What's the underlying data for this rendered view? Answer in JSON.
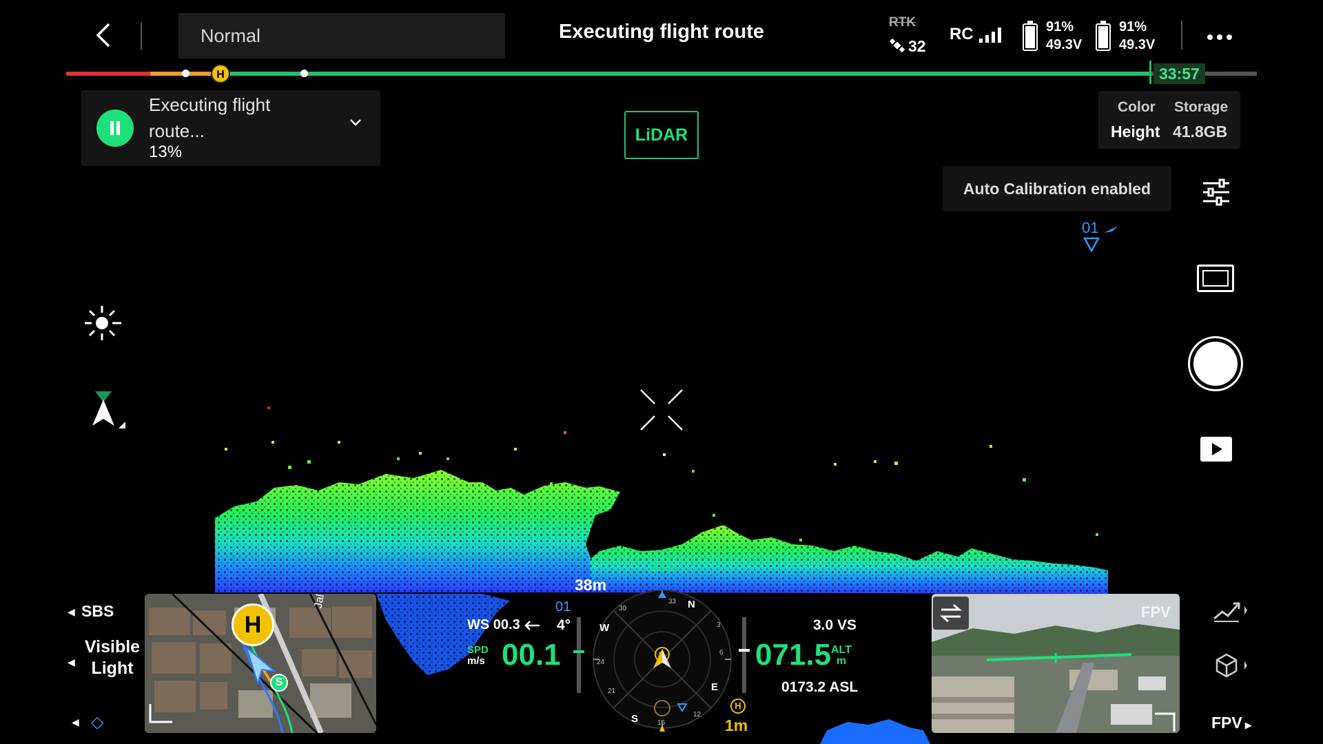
{
  "header": {
    "mode": "Normal",
    "title": "Executing flight route",
    "rtk_label": "RTK",
    "satellites": "32",
    "rc_label": "RC",
    "batteries": [
      {
        "percent": "91%",
        "voltage": "49.3V"
      },
      {
        "percent": "91%",
        "voltage": "49.3V"
      }
    ],
    "more_icon": "more-dots-icon"
  },
  "timeline": {
    "home_marker": "H",
    "remaining_time": "33:57"
  },
  "task": {
    "status": "Executing flight route...",
    "progress": "13%"
  },
  "sensor_toggle": "LiDAR",
  "info_panel": {
    "color_label": "Color",
    "color_value": "Height",
    "storage_label": "Storage",
    "storage_value": "41.8GB"
  },
  "calibration_badge": "Auto Calibration enabled",
  "waypoint_label": "01",
  "bottom_left": {
    "sbs_label": "SBS",
    "view_label": "Visible Light"
  },
  "map": {
    "home_marker": "H",
    "start_marker": "S",
    "road_label": "Jal"
  },
  "fpv": {
    "tag": "FPV",
    "button_label": "FPV"
  },
  "flight": {
    "wind_speed": "WS 00.3",
    "spd_label": "SPD",
    "spd_unit": "m/s",
    "speed": "00.1",
    "tilt": "4°",
    "distance": "38m",
    "heading": "335",
    "waypoint": "01",
    "vertical_speed": "3.0 VS",
    "altitude": "071.5",
    "alt_label": "ALT",
    "alt_unit": "m",
    "asl": "0173.2 ASL",
    "home_distance": "1m"
  },
  "compass": {
    "n": "N",
    "e": "E",
    "s": "S",
    "w": "W",
    "t30": "30",
    "t3": "3",
    "t6": "6",
    "t12": "12",
    "t15": "15",
    "t21": "21",
    "t24": "24",
    "t33": "33",
    "home_marker": "H"
  },
  "colors": {
    "accent": "#1ee07a",
    "home": "#f2c200",
    "route_red": "#e23131",
    "route_orange": "#ef9a2a",
    "waypoint": "#2a9dff"
  }
}
